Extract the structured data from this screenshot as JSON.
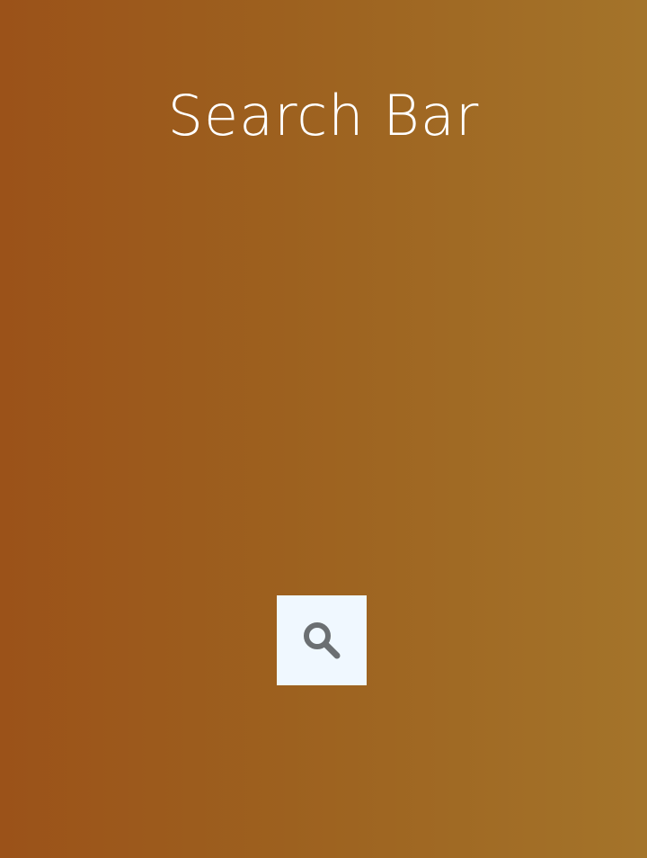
{
  "header": {
    "title": "Search Bar"
  },
  "search": {
    "button_icon": "search-icon",
    "button_background": "#f0f8ff",
    "icon_color": "#6b6f72"
  },
  "colors": {
    "background_gradient_start": "#9b5219",
    "background_gradient_end": "#a4742a",
    "title_color": "#ffffff"
  }
}
